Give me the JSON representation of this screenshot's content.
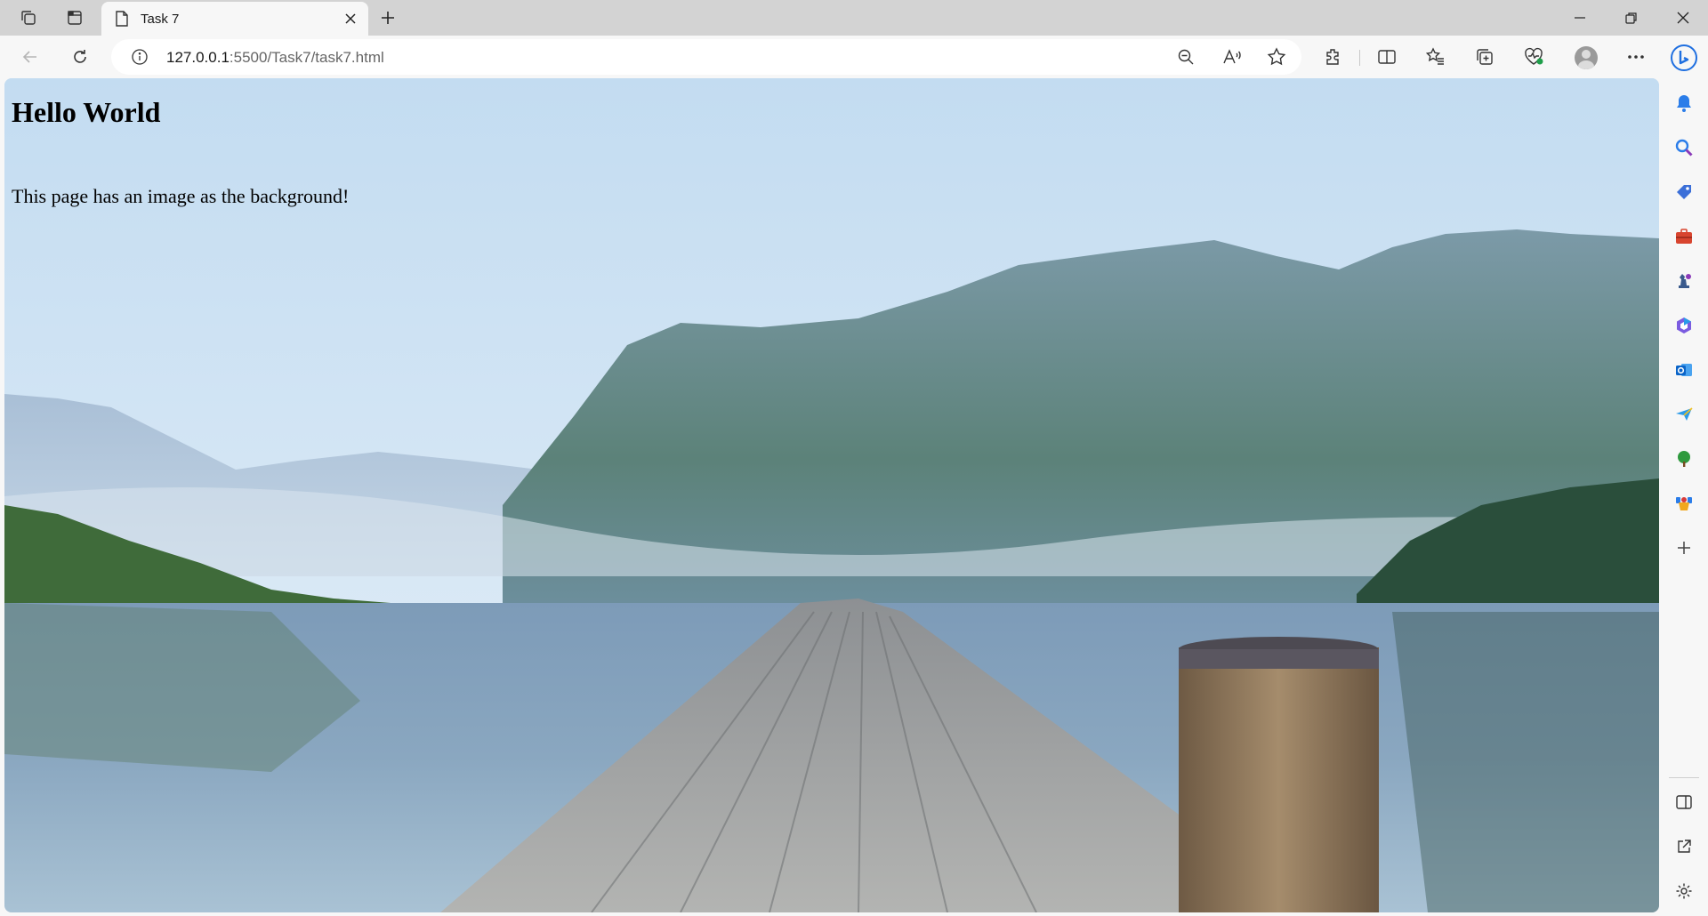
{
  "browser": {
    "tab": {
      "title": "Task 7"
    },
    "address": {
      "host": "127.0.0.1",
      "rest": ":5500/Task7/task7.html"
    }
  },
  "page": {
    "heading": "Hello World",
    "paragraph": "This page has an image as the background!"
  },
  "icons": {
    "tabstrip": [
      "workspaces-icon",
      "vertical-tabs-icon",
      "page-favicon-icon",
      "close-icon",
      "new-tab-icon"
    ],
    "window": [
      "minimize-icon",
      "restore-icon",
      "close-window-icon"
    ],
    "nav": [
      "back-icon",
      "refresh-icon",
      "info-icon"
    ],
    "omnibox": [
      "zoom-out-icon",
      "read-aloud-icon",
      "favorite-star-icon"
    ],
    "toolbar": [
      "extensions-icon",
      "split-screen-icon",
      "favorites-icon",
      "collections-icon",
      "browser-essentials-icon",
      "profile-avatar",
      "more-menu-icon"
    ],
    "sidebar": [
      "copilot-icon",
      "notifications-bell-icon",
      "search-icon",
      "shopping-tag-icon",
      "tools-briefcase-icon",
      "games-chess-icon",
      "microsoft-365-icon",
      "outlook-icon",
      "send-icon",
      "tree-icon",
      "office-icon",
      "add-icon",
      "hide-sidebar-icon",
      "open-external-icon",
      "settings-gear-icon"
    ]
  },
  "colors": {
    "chrome": "#f7f7f7",
    "tabstrip": "#d3d3d3",
    "sky": "#cfe3f3",
    "copilot": "#1f6fe0"
  }
}
